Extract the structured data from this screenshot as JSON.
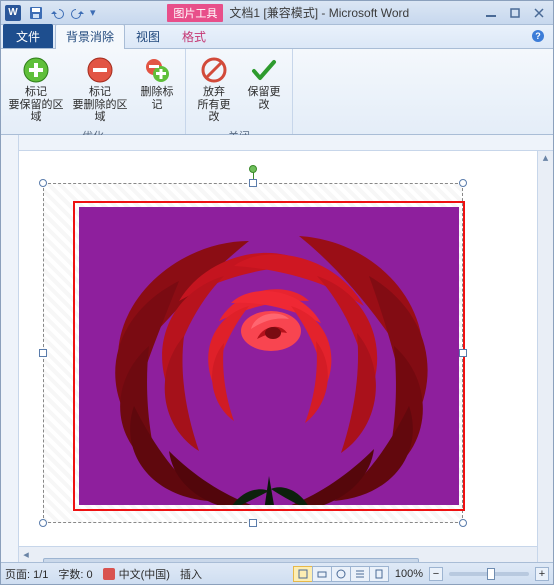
{
  "title": {
    "contextual_label": "图片工具",
    "doc_name": "文档1 [兼容模式] - Microsoft Word",
    "app_letter": "W"
  },
  "qat": {
    "save_tip": "保存",
    "undo_tip": "撤销",
    "redo_tip": "重复"
  },
  "tabs": {
    "file": "文件",
    "bg_remove": "背景消除",
    "view": "视图",
    "format": "格式"
  },
  "ribbon": {
    "optimize_group": "优化",
    "close_group": "关闭",
    "mark_keep": {
      "line1": "标记",
      "line2": "要保留的区域"
    },
    "mark_remove": {
      "line1": "标记",
      "line2": "要删除的区域"
    },
    "delete_mark": {
      "line1": "删除标记"
    },
    "discard": {
      "line1": "放弃",
      "line2": "所有更改"
    },
    "keep": {
      "line1": "保留更改"
    }
  },
  "status": {
    "page": "页面: 1/1",
    "words": "字数: 0",
    "lang": "中文(中国)",
    "mode": "插入",
    "zoom": "100%"
  },
  "colors": {
    "accent_add": "#34a51e",
    "accent_remove": "#d63a2e",
    "accent_ok": "#2e9b2e",
    "contextual": "#e84f8a",
    "img_bg": "#8e1f9d"
  }
}
